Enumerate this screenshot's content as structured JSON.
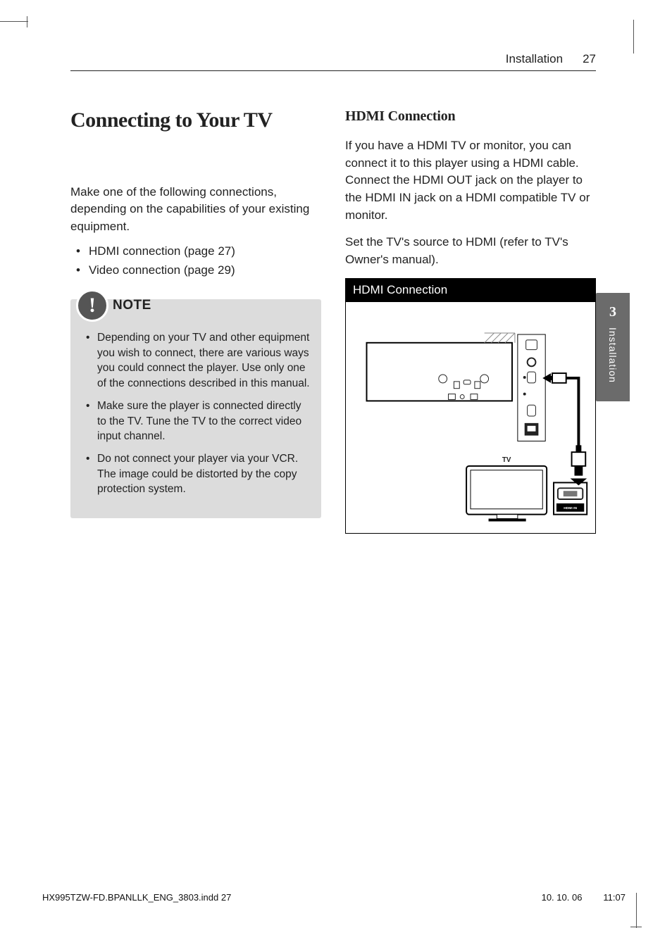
{
  "header": {
    "section": "Installation",
    "page_number": "27"
  },
  "left": {
    "title": "Connecting to Your TV",
    "intro": "Make one of the following connections, depending on the capabilities of your existing equipment.",
    "bullets": [
      "HDMI connection (page 27)",
      "Video connection (page 29)"
    ],
    "note_label": "NOTE",
    "note_items": [
      "Depending on your TV and other equipment you wish to connect, there are various ways you could connect the player. Use only one of the connections described in this manual.",
      "Make sure the player is connected directly to the TV. Tune the TV to the correct video input channel.",
      "Do not connect your player via your VCR. The image could be distorted by the copy protection system."
    ]
  },
  "right": {
    "subheading": "HDMI Connection",
    "para1": "If you have a HDMI TV or monitor, you can connect it to this player using a HDMI cable. Connect the HDMI OUT jack on the player to the HDMI IN jack on a HDMI compatible TV or monitor.",
    "para2": "Set the TV's source to HDMI (refer to TV's Owner's manual).",
    "diagram_title": "HDMI Connection",
    "diagram_tv_label": "TV",
    "diagram_hdmi_in": "HDMI IN"
  },
  "side_tab": {
    "number": "3",
    "label": "Installation"
  },
  "footer": {
    "file": "HX995TZW-FD.BPANLLK_ENG_3803.indd   27",
    "date": "10. 10. 06",
    "time": "11:07"
  }
}
